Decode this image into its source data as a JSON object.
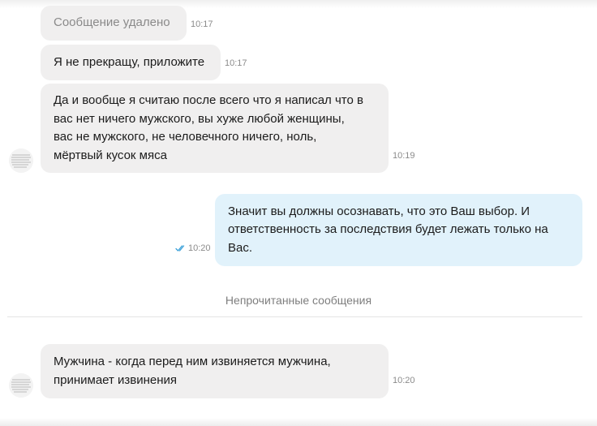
{
  "messages": [
    {
      "text": "Сообщение удалено",
      "time": "10:17"
    },
    {
      "text": "Я не прекращу, приложите",
      "time": "10:17"
    },
    {
      "text": "Да и вообще я считаю после всего что я написал что в\nвас нет ничего мужского, вы хуже любой женщины,\nвас не мужского, не человечного ничего,  ноль,\nмёртвый кусок мяса",
      "time": "10:19"
    },
    {
      "text": "Значит вы должны осознавать, что это Ваш выбор. И\nответственность за последствия будет лежать только на\nВас.",
      "time": "10:20"
    },
    {
      "text": "Мужчина - когда перед ним извиняется мужчина,\nпринимает извинения",
      "time": "10:20"
    }
  ],
  "divider": {
    "label": "Непрочитанные сообщения"
  },
  "colors": {
    "incoming_bubble": "#f0efef",
    "outgoing_bubble": "#e1f2fb",
    "read_check": "#3aa0d8",
    "divider_line": "#e4e4e4"
  },
  "icons": {
    "read_status": "double-check-icon",
    "sender": "avatar"
  }
}
